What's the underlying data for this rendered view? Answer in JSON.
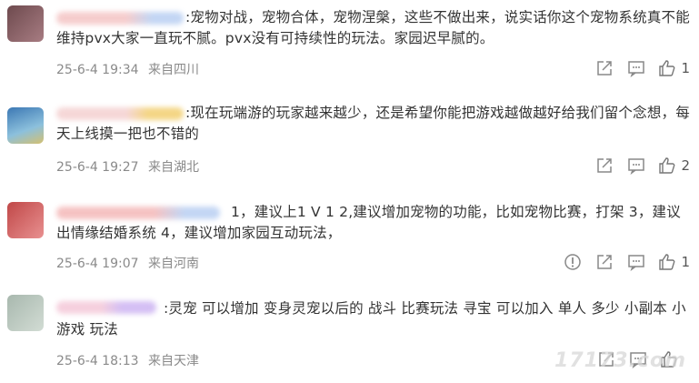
{
  "comments": [
    {
      "text": ":宠物对战，宠物合体，宠物涅槃，这些不做出来，说实话你这个宠物系统真不能维持pvx大家一直玩不腻。pvx没有可持续性的玩法。家园迟早腻的。",
      "date": "25-6-4 19:34",
      "location": "来自四川",
      "likes": "1",
      "avatar_color": "#8a5a5e",
      "name_colors": [
        "#f0b8b8",
        "#b8cdf0"
      ],
      "report": false
    },
    {
      "text": ":现在玩端游的玩家越来越少，还是希望你能把游戏越做越好给我们留个念想，每天上线摸一把也不错的",
      "date": "25-6-4 19:27",
      "location": "来自湖北",
      "likes": "2",
      "avatar_color": "#5a8ab0",
      "name_colors": [
        "#f2c8c8",
        "#f2cf70"
      ],
      "report": false
    },
    {
      "text": "1，建议上1 V 1 2,建议增加宠物的功能，比如宠物比赛，打架 3，建议出情缘结婚系统 4，建议增加家园互动玩法，",
      "date": "25-6-4 19:07",
      "location": "来自河南",
      "likes": "1",
      "avatar_color": "#d06a6a",
      "name_colors": [
        "#f0b0b0",
        "#b8cdf0"
      ],
      "report": true
    },
    {
      "text": ":灵宠  可以增加  变身灵宠以后的 战斗  比赛玩法 寻宝  可以加入  单人 多少 小副本 小游戏 玩法",
      "date": "25-6-4 18:13",
      "location": "来自天津",
      "likes": "",
      "avatar_color": "#b8c4bc",
      "name_colors": [
        "#f0c0d0",
        "#c8b0f0"
      ],
      "report": false
    }
  ],
  "icons": {
    "share": "share-icon",
    "comment": "comment-icon",
    "like": "thumbs-up-icon",
    "report": "report-icon"
  },
  "watermark": "17173.com"
}
